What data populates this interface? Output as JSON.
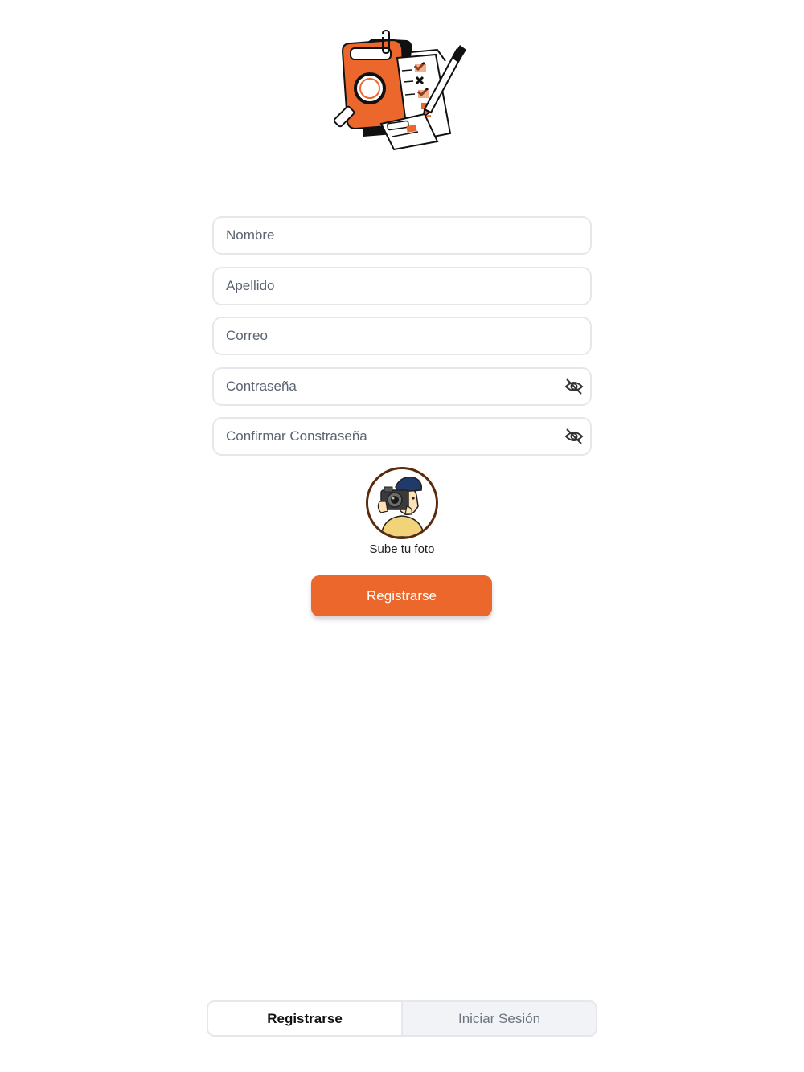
{
  "form": {
    "fields": [
      {
        "placeholder": "Nombre",
        "value": ""
      },
      {
        "placeholder": "Apellido",
        "value": ""
      },
      {
        "placeholder": "Correo",
        "value": ""
      },
      {
        "placeholder": "Contraseña",
        "value": ""
      },
      {
        "placeholder": "Confirmar Constraseña",
        "value": ""
      }
    ],
    "password_icon": "eye-off-icon",
    "photo_label": "Sube tu foto",
    "submit_label": "Registrarse"
  },
  "tabs": {
    "items": [
      {
        "label": "Registrarse",
        "active": true
      },
      {
        "label": "Iniciar Sesión",
        "active": false
      }
    ]
  },
  "colors": {
    "accent": "#ec672b",
    "avatar_border": "#5a2a0c",
    "field_border": "#e5e7eb",
    "placeholder": "#5b6472"
  }
}
